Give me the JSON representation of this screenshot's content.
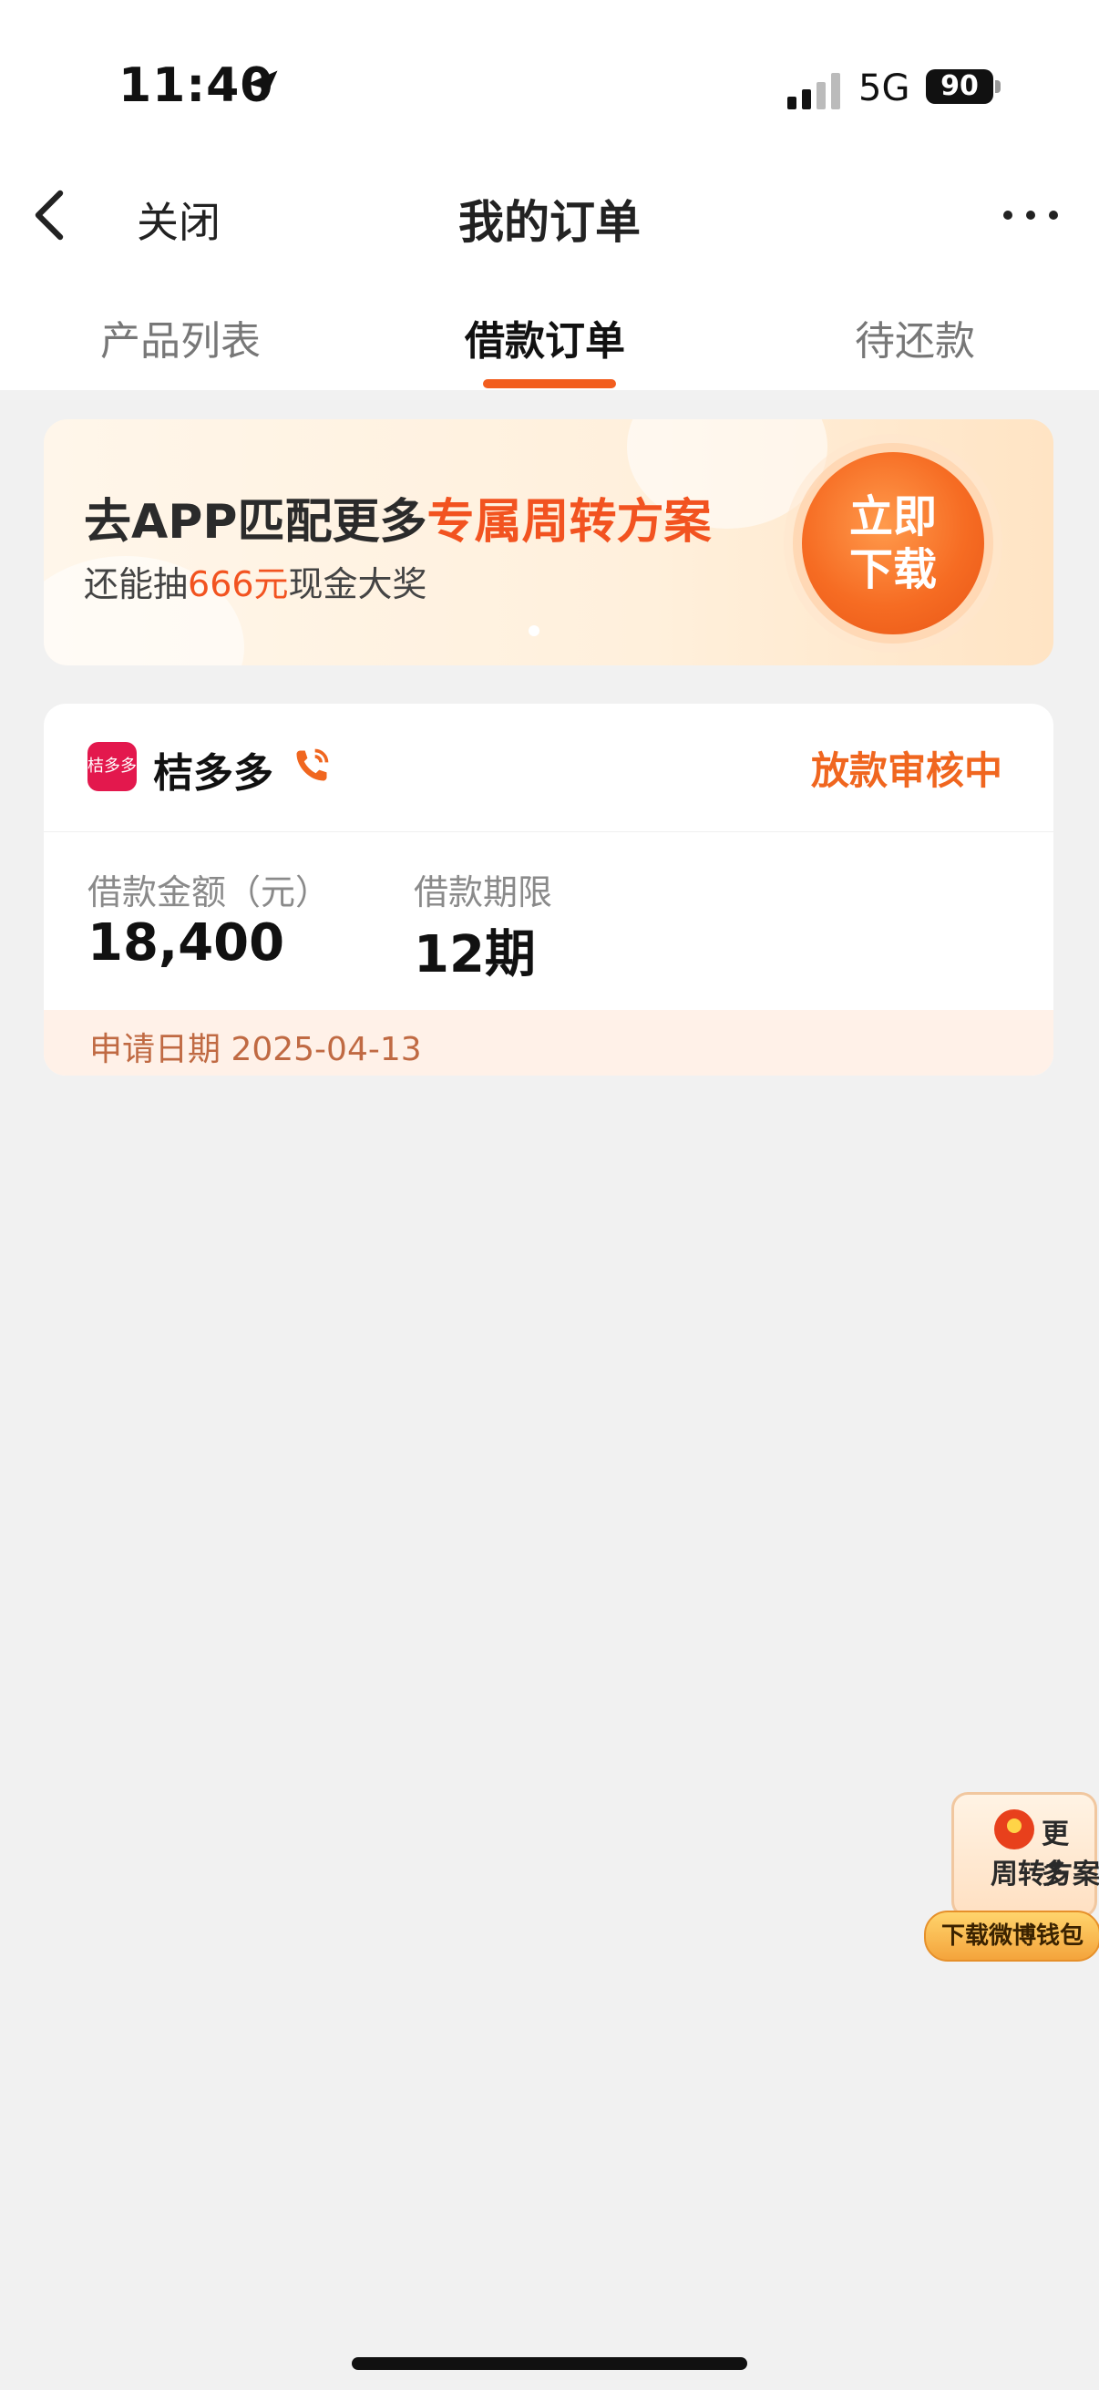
{
  "status_bar": {
    "time": "11:40",
    "network": "5G",
    "battery": "90"
  },
  "nav": {
    "close_label": "关闭",
    "title": "我的订单"
  },
  "tabs": [
    {
      "label": "产品列表",
      "active": false
    },
    {
      "label": "借款订单",
      "active": true
    },
    {
      "label": "待还款",
      "active": false
    }
  ],
  "banner": {
    "title_prefix": "去APP匹配更多",
    "title_highlight": "专属周转方案",
    "sub_prefix": "还能抽",
    "sub_highlight": "666元",
    "sub_suffix": "现金大奖",
    "button_line1": "立即",
    "button_line2": "下载"
  },
  "order": {
    "app_logo_text": "桔多多",
    "app_name": "桔多多",
    "status": "放款审核中",
    "amount_label": "借款金额（元）",
    "amount_value": "18,400",
    "term_label": "借款期限",
    "term_value": "12期",
    "apply_date": "申请日期 2025-04-13"
  },
  "float_promo": {
    "line1": "更多",
    "line2": "周转方案",
    "button": "下载微博钱包"
  },
  "colors": {
    "accent": "#f25d1e",
    "status": "#f0661f",
    "highlight": "#f25320"
  }
}
